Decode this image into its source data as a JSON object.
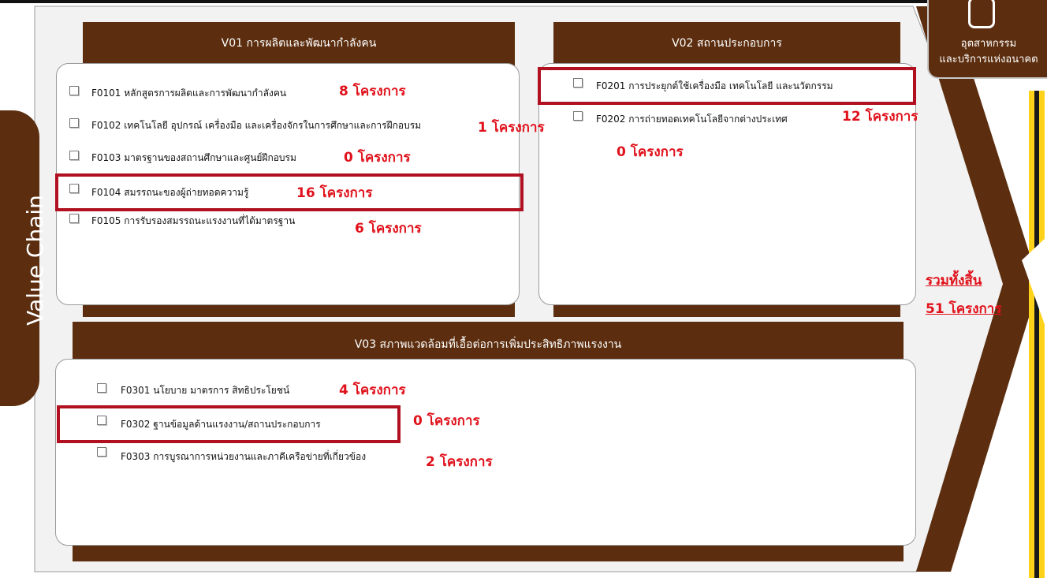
{
  "side_label": "Value Chain",
  "logo": {
    "line1": "อุตสาหกรรม",
    "line2": "และบริการแห่งอนาคต",
    "icon": "robot-icon"
  },
  "sections": {
    "v01": {
      "title": "V01 การผลิตและพัฒนากำลังคน",
      "items": [
        {
          "label": "F0101 หลักสูตรการผลิตและการพัฒนากำลังคน",
          "count": "8 โครงการ"
        },
        {
          "label": "F0102 เทคโนโลยี อุปกรณ์ เครื่องมือ และเครื่องจักรในการศึกษาและการฝึกอบรม",
          "count": "1 โครงการ"
        },
        {
          "label": "F0103 มาตรฐานของสถานศึกษาและศูนย์ฝึกอบรม",
          "count": "0 โครงการ"
        },
        {
          "label": "F0104 สมรรถนะของผู้ถ่ายทอดความรู้",
          "count": "16 โครงการ"
        },
        {
          "label": "F0105 การรับรองสมรรถนะแรงงานที่ได้มาตรฐาน",
          "count": "6 โครงการ"
        }
      ]
    },
    "v02": {
      "title": "V02 สถานประกอบการ",
      "items": [
        {
          "label": "F0201 การประยุกต์ใช้เครื่องมือ เทคโนโลยี และนวัตกรรม",
          "count": "12 โครงการ"
        },
        {
          "label": "F0202 การถ่ายทอดเทคโนโลยีจากต่างประเทศ",
          "count": "0 โครงการ"
        }
      ]
    },
    "v03": {
      "title": "V03 สภาพแวดล้อมที่เอื้อต่อการเพิ่มประสิทธิภาพแรงงาน",
      "items": [
        {
          "label": "F0301 นโยบาย มาตรการ สิทธิประโยชน์",
          "count": "4 โครงการ"
        },
        {
          "label": "F0302 ฐานข้อมูลด้านแรงงาน/สถานประกอบการ",
          "count": "0 โครงการ"
        },
        {
          "label": "F0303 การบูรณาการหน่วยงานและภาคีเครือข่ายที่เกี่ยวข้อง",
          "count": "2 โครงการ"
        }
      ]
    }
  },
  "total": {
    "label": "รวมทั้งสิ้น",
    "count": "51 โครงการ"
  },
  "colors": {
    "brown": "#5c2e0f",
    "highlight": "#b01020",
    "count_red": "#e0111b",
    "panel": "#f2f2f2"
  }
}
